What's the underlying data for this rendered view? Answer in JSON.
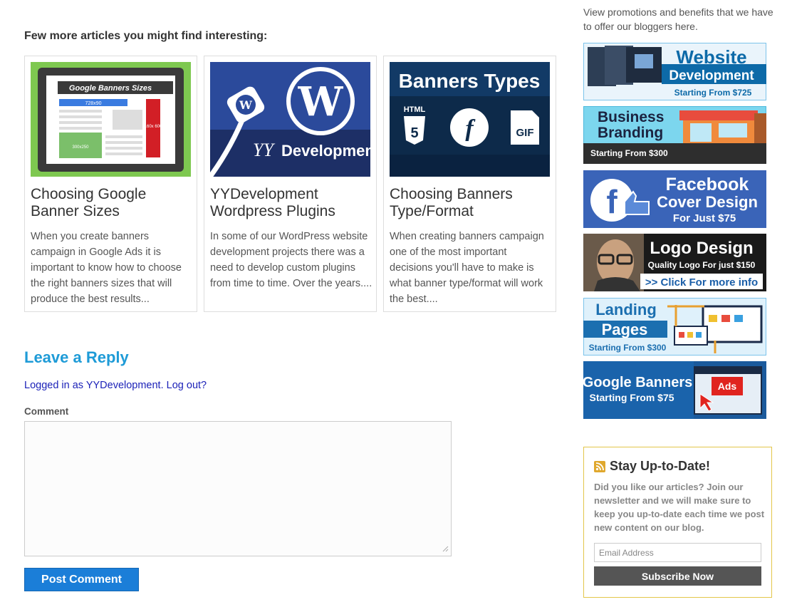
{
  "related": {
    "heading": "Few more articles you might find interesting:",
    "cards": [
      {
        "title": "Choosing Google Banner Sizes",
        "excerpt": "When you create banners campaign in Google Ads it is important to know how to choose the right banners sizes that will produce the best results...",
        "image": {
          "heading": "Google Banners Sizes",
          "label_top": "728x90",
          "label_side": "160x 600",
          "label_box": "300x250"
        }
      },
      {
        "title": "YYDevelopment Wordpress Plugins",
        "excerpt": "In some of our WordPress website development projects there was a need to develop custom plugins from time to time. Over the years....",
        "image": {
          "brand": "Development"
        }
      },
      {
        "title": "Choosing Banners Type/Format",
        "excerpt": "When creating banners campaign one of the most important decisions you'll have to make is what banner type/format will work the best....",
        "image": {
          "heading": "Banners Types",
          "html": "HTML",
          "gif": "GIF"
        }
      }
    ]
  },
  "reply": {
    "heading": "Leave a Reply",
    "logged_prefix": "Logged in as ",
    "user": "YYDevelopment",
    "logout": "Log out?",
    "comment_label": "Comment",
    "comment_value": "",
    "submit": "Post Comment"
  },
  "sidebar": {
    "promo_text": "View promotions and benefits that we have to offer our bloggers here.",
    "ads": [
      {
        "l1": "Website",
        "l2": "Development",
        "l3": "Starting From $725"
      },
      {
        "l1": "Business",
        "l2": "Branding",
        "l3": "Starting From $300"
      },
      {
        "l1": "Facebook",
        "l2": "Cover Design",
        "l3": "For Just $75"
      },
      {
        "l1": "Logo Design",
        "l2": "Quality Logo For just $150",
        "l3": ">> Click For more info"
      },
      {
        "l1": "Landing",
        "l2": "Pages",
        "l3": "Starting From $300"
      },
      {
        "l1": "Google Banners",
        "l2": "Starting From $75",
        "l3": "Ads"
      }
    ],
    "newsletter": {
      "title": "Stay Up-to-Date!",
      "description": "Did you like our articles? Join our newsletter and we will make sure to keep you up-to-date each time we post new content on our blog.",
      "email_placeholder": "Email Address",
      "button": "Subscribe Now"
    }
  },
  "colors": {
    "accent": "#1e9bd7",
    "link": "#1c22b8",
    "button": "#1b7ed8",
    "newsletter_border": "#e3c64a"
  }
}
